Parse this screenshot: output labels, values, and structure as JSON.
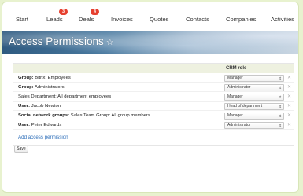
{
  "nav": {
    "items": [
      {
        "label": "Start"
      },
      {
        "label": "Leads",
        "badge": "3"
      },
      {
        "label": "Deals",
        "badge": "4"
      },
      {
        "label": "Invoices"
      },
      {
        "label": "Quotes"
      },
      {
        "label": "Contacts"
      },
      {
        "label": "Companies"
      },
      {
        "label": "Activities"
      }
    ]
  },
  "page": {
    "title": "Access Permissions"
  },
  "table": {
    "header_crm_role": "CRM role",
    "rows": [
      {
        "prefix": "Group:",
        "name": "Bitrix: Employees",
        "role": "Manager"
      },
      {
        "prefix": "Group:",
        "name": "Administrators",
        "role": "Administrator"
      },
      {
        "prefix": "",
        "name": "Sales Department: All department employees",
        "role": "Manager"
      },
      {
        "prefix": "User:",
        "name": "Jacob Newton",
        "role": "Head of department"
      },
      {
        "prefix": "Social network groups:",
        "name": "Sales Team Group: All group members",
        "role": "Manager"
      },
      {
        "prefix": "User:",
        "name": "Peter Edwards",
        "role": "Administrator"
      }
    ],
    "add_link": "Add access permission"
  },
  "actions": {
    "save_label": "Save"
  },
  "colors": {
    "background": "#e8f2cf",
    "badge": "#e6402f",
    "link": "#2a6cb8",
    "table_header": "#eef1e0"
  }
}
